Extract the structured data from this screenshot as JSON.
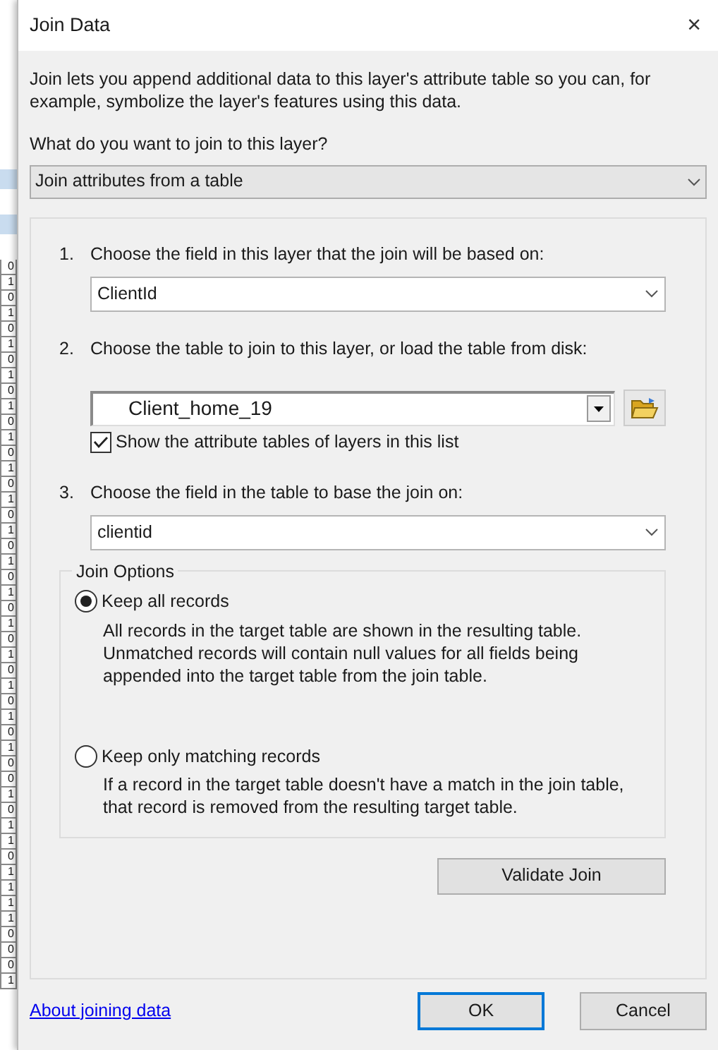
{
  "background_table": {
    "cells": [
      "0",
      "1",
      "0",
      "1",
      "0",
      "1",
      "0",
      "1",
      "0",
      "1",
      "0",
      "1",
      "0",
      "1",
      "0",
      "1",
      "0",
      "1",
      "0",
      "1",
      "0",
      "1",
      "0",
      "1",
      "0",
      "1",
      "0",
      "1",
      "0",
      "1",
      "0",
      "1",
      "0",
      "0",
      "1",
      "0",
      "1",
      "1",
      "0",
      "1",
      "1",
      "1",
      "1",
      "0",
      "0",
      "0",
      "1"
    ]
  },
  "window": {
    "title": "Join Data",
    "close": "×"
  },
  "intro": "Join lets you append additional data to this layer's attribute table so you can, for example, symbolize the layer's features using this data.",
  "join_type": {
    "label": "What do you want to join to this layer?",
    "value": "Join attributes from a table"
  },
  "steps": [
    {
      "number": "1.",
      "text": "Choose the field in this layer that the join will be based on:",
      "kind": "combo",
      "value": "ClientId"
    },
    {
      "number": "2.",
      "text": "Choose the table to join to this layer, or load the table from disk:",
      "kind": "table",
      "value": "Client_home_19",
      "checkbox": {
        "label": "Show the attribute tables of layers in this list",
        "checked": true
      }
    },
    {
      "number": "3.",
      "text": "Choose the field in the table to base the join on:",
      "kind": "combo",
      "value": "clientid"
    }
  ],
  "join_options": {
    "title": "Join Options",
    "options": [
      {
        "label": "Keep all records",
        "selected": true,
        "description": "All records in the target table are shown in the resulting table. Unmatched records will contain null values for all fields being appended into the target table from the join table."
      },
      {
        "label": "Keep only matching records",
        "selected": false,
        "description": "If a record in the target table doesn't have a match in the join table, that record is removed from the resulting target table."
      }
    ]
  },
  "validate_button": "Validate Join",
  "help_link": "About joining data",
  "buttons": [
    {
      "label": "OK",
      "default": true
    },
    {
      "label": "Cancel",
      "default": false
    }
  ]
}
